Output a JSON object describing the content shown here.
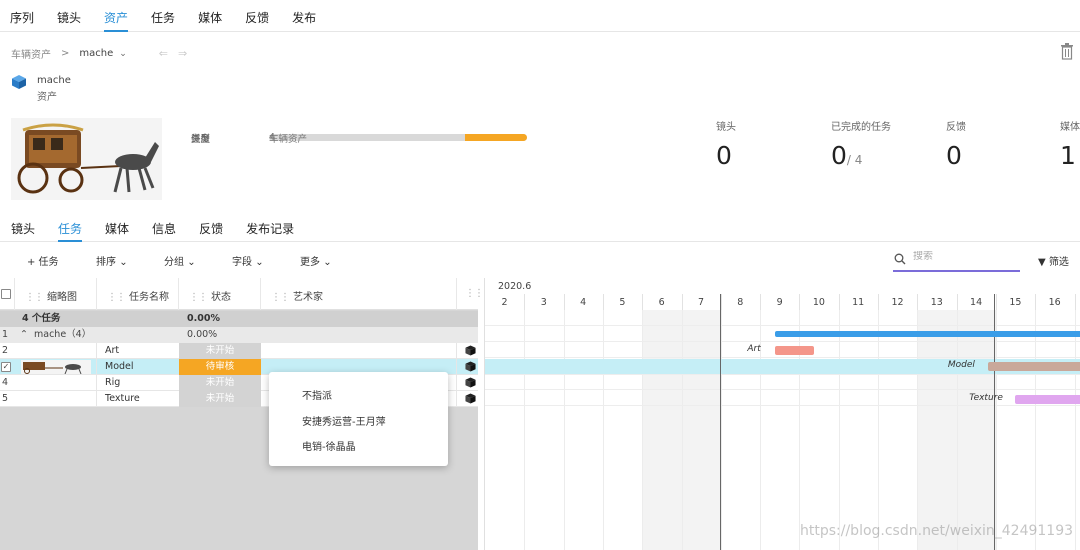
{
  "top_tabs": [
    "序列",
    "镜头",
    "资产",
    "任务",
    "媒体",
    "反馈",
    "发布"
  ],
  "top_active": "资产",
  "breadcrumb": {
    "parent": "车辆资产",
    "sep": ">",
    "current": "mache"
  },
  "asset": {
    "name": "mache",
    "type_label": "资产"
  },
  "info": {
    "progress_label": "进度",
    "progress_value": 0.24,
    "type_label": "类型",
    "type_value": "车辆资产",
    "tasks_label": "任务",
    "tasks_value": "4"
  },
  "stats": [
    {
      "label": "镜头",
      "value": "0",
      "sub": ""
    },
    {
      "label": "已完成的任务",
      "value": "0",
      "sub": "/ 4"
    },
    {
      "label": "反馈",
      "value": "0",
      "sub": ""
    },
    {
      "label": "媒体",
      "value": "1",
      "sub": ""
    }
  ],
  "sub_tabs": [
    "镜头",
    "任务",
    "媒体",
    "信息",
    "反馈",
    "发布记录"
  ],
  "sub_active": "任务",
  "toolbar": {
    "add": "+ 任务",
    "sort": "排序",
    "group": "分组",
    "fields": "字段",
    "more": "更多",
    "search_placeholder": "搜索",
    "filter": "筛选"
  },
  "columns": [
    "缩略图",
    "任务名称",
    "状态",
    "艺术家"
  ],
  "summary": {
    "label": "4 个任务",
    "percent": "0.00%"
  },
  "group_row": {
    "index": "1",
    "label": "mache（4）",
    "percent": "0.00%"
  },
  "tasks": [
    {
      "index": "2",
      "name": "Art",
      "status": "未开始",
      "status_color": "#d3d3d3",
      "checked": false
    },
    {
      "index": "3",
      "name": "Model",
      "status": "待审核",
      "status_color": "#f5a623",
      "checked": true
    },
    {
      "index": "4",
      "name": "Rig",
      "status": "未开始",
      "status_color": "#d3d3d3",
      "checked": false
    },
    {
      "index": "5",
      "name": "Texture",
      "status": "未开始",
      "status_color": "#d3d3d3",
      "checked": false
    }
  ],
  "dropdown": [
    "不指派",
    "安捷秀运营-王月萍",
    "电销-徐晶晶"
  ],
  "gantt": {
    "month": "2020.6",
    "days": [
      "2",
      "3",
      "4",
      "5",
      "6",
      "7",
      "8",
      "9",
      "10",
      "11",
      "12",
      "13",
      "14",
      "15",
      "16"
    ],
    "bar_labels": [
      "Art",
      "Model",
      "Texture"
    ],
    "colors": {
      "group": "#3a9de8",
      "art": "#f4968a",
      "model": "#c9a89a",
      "texture": "#e0a6ef"
    }
  },
  "watermark": "https://blog.csdn.net/weixin_42491193"
}
